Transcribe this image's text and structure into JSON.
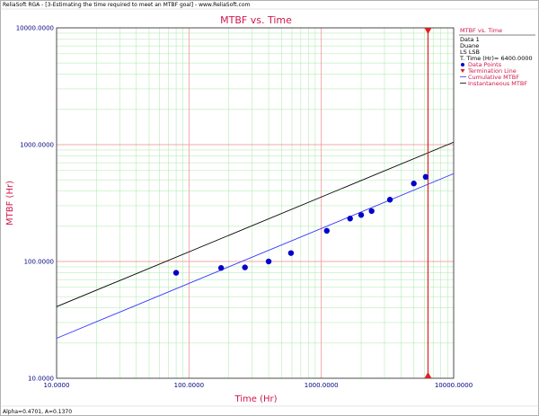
{
  "window": {
    "title": "ReliaSoft RGA - [3-Estimating the time required to meet an MTBF goal] - www.ReliaSoft.com",
    "status": "Alpha=0.4701, A=0.1370"
  },
  "colors": {
    "title": "#d0174a",
    "tick": "#000080",
    "grid_major": "#f08a8a",
    "grid_minor": "#a8e8a8",
    "points": "#0000c8",
    "cumulative": "#3535ff",
    "instantaneous": "#000000",
    "termination": "#e02020"
  },
  "legend": {
    "title": "MTBF vs. Time",
    "info": [
      "Data 1",
      "Duane",
      "LS LSB",
      "T. Time (Hr)= 6400.0000"
    ],
    "items": [
      {
        "label": "Data Points",
        "marker": "dot"
      },
      {
        "label": "Termination Line",
        "marker": "triangle"
      },
      {
        "label": "Cumulative MTBF",
        "marker": "line-blue"
      },
      {
        "label": "Instantaneous MTBF",
        "marker": "line-black"
      }
    ]
  },
  "chart_data": {
    "type": "scatter",
    "title": "MTBF vs. Time",
    "xlabel": "Time (Hr)",
    "ylabel": "MTBF (Hr)",
    "xscale": "log",
    "yscale": "log",
    "xlim": [
      10,
      10000
    ],
    "ylim": [
      10,
      10000
    ],
    "grid": true,
    "legend_position": "right",
    "x_ticks": [
      "10.0000",
      "100.0000",
      "1000.0000",
      "10000.0000"
    ],
    "y_ticks": [
      "10.0000",
      "100.0000",
      "1000.0000",
      "10000.0000"
    ],
    "series": [
      {
        "name": "Data Points",
        "kind": "points",
        "x": [
          80,
          175,
          265,
          400,
          590,
          1100,
          1650,
          2000,
          2400,
          3300,
          5000,
          6150
        ],
        "y": [
          80,
          88,
          89,
          100,
          118,
          183,
          233,
          250,
          270,
          338,
          465,
          530
        ]
      },
      {
        "name": "Cumulative MTBF",
        "kind": "line",
        "x": [
          10,
          10000
        ],
        "y": [
          22,
          565
        ]
      },
      {
        "name": "Instantaneous MTBF",
        "kind": "line",
        "x": [
          10,
          10000
        ],
        "y": [
          41,
          1050
        ]
      },
      {
        "name": "Termination Line",
        "kind": "vline",
        "x": 6400
      }
    ]
  }
}
